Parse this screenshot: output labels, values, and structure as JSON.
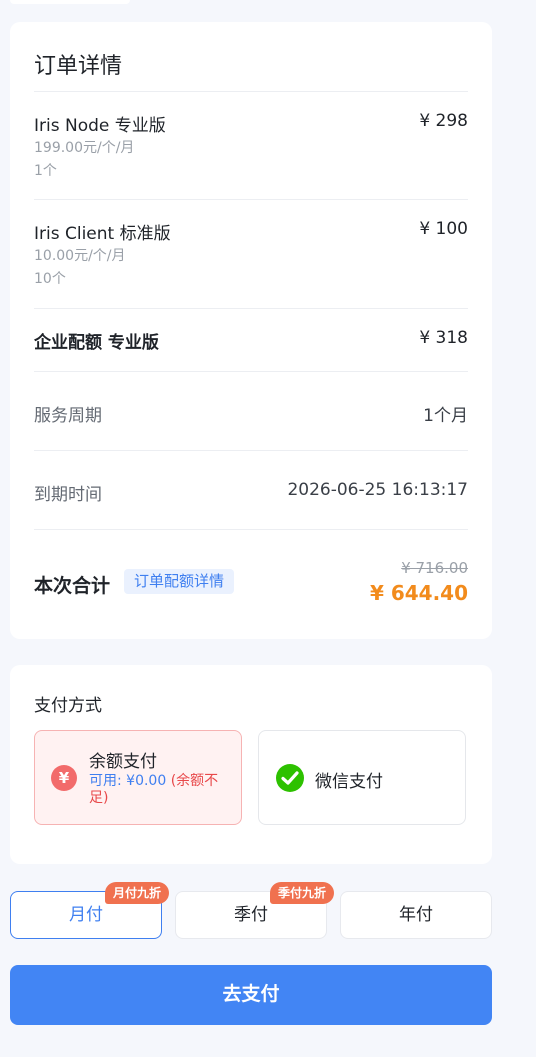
{
  "order": {
    "title": "订单详情",
    "items": [
      {
        "name": "Iris Node 专业版",
        "price": "¥ 298",
        "unit_price": "199.00元/个/月",
        "quantity": "1个"
      },
      {
        "name": "Iris Client 标准版",
        "price": "¥ 100",
        "unit_price": "10.00元/个/月",
        "quantity": "10个"
      },
      {
        "name": "企业配额 专业版",
        "price": "¥ 318"
      }
    ],
    "service_period": {
      "label": "服务周期",
      "value": "1个月"
    },
    "expire_time": {
      "label": "到期时间",
      "value": "2026-06-25 16:13:17"
    },
    "total": {
      "label": "本次合计",
      "detail_link": "订单配额详情",
      "original_price": "¥ 716.00",
      "final_price": "¥ 644.40"
    }
  },
  "payment": {
    "title": "支付方式",
    "balance": {
      "icon": "yen-icon",
      "label": "余额支付",
      "available": "可用: ¥0.00",
      "warning": "(余额不足)"
    },
    "wechat": {
      "icon": "wechat-icon",
      "label": "微信支付"
    }
  },
  "billing_cycle": {
    "options": [
      {
        "label": "月付",
        "badge": "月付九折",
        "active": true
      },
      {
        "label": "季付",
        "badge": "季付九折",
        "active": false
      },
      {
        "label": "年付",
        "active": false
      }
    ]
  },
  "submit": {
    "label": "去支付"
  },
  "colors": {
    "accent": "#4285f4",
    "price_highlight": "#f28b1c",
    "badge": "#f0714f",
    "warning": "#e8484a",
    "wechat": "#2dc100"
  }
}
